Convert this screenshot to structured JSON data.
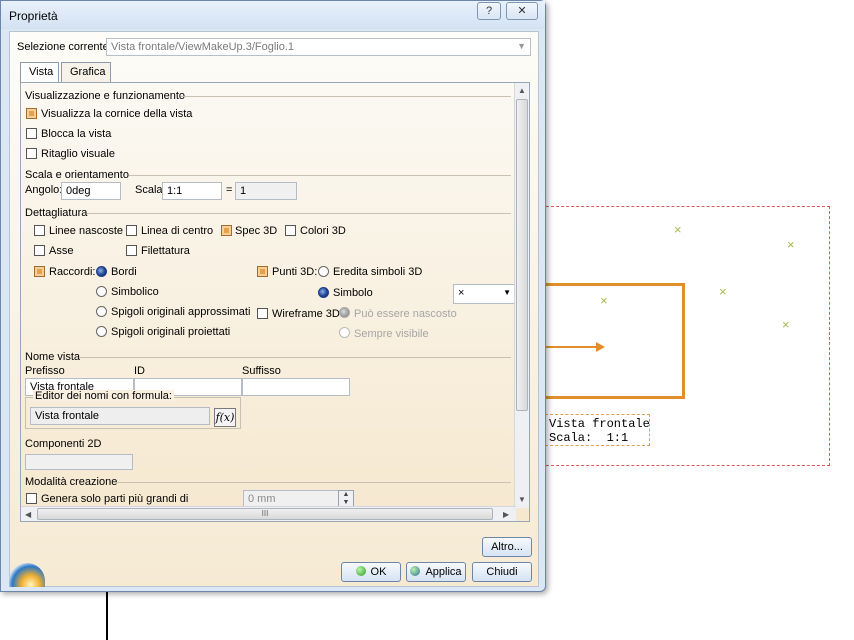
{
  "drawing": {
    "view_label_line1": "Vista frontale",
    "view_label_line2": "Scala:  1:1",
    "x_glyph": "×"
  },
  "dialog": {
    "title": "Proprietà",
    "help_label": "?",
    "close_label": "✕",
    "current_selection_label": "Selezione corrente:",
    "current_selection_value": "Vista frontale/ViewMakeUp.3/Foglio.1",
    "tabs": [
      {
        "label": "Vista",
        "active": true
      },
      {
        "label": "Grafica",
        "active": false
      }
    ],
    "visualization": {
      "section_title": "Visualizzazione e funzionamento",
      "show_frame_label": "Visualizza la cornice della vista",
      "show_frame_checked": true,
      "lock_view_label": "Blocca la vista",
      "lock_view_checked": false,
      "visual_clipping_label": "Ritaglio visuale",
      "visual_clipping_checked": false
    },
    "scale": {
      "section_title": "Scala e orientamento",
      "angle_label": "Angolo:",
      "angle_value": "0deg",
      "scale_label": "Scala:",
      "scale_value": "1:1",
      "equals_label": "=",
      "scale_result": "1"
    },
    "detail": {
      "section_title": "Dettagliatura",
      "hidden_lines_label": "Linee nascoste",
      "hidden_lines_checked": false,
      "center_line_label": "Linea di centro",
      "center_line_checked": false,
      "spec3d_label": "Spec 3D",
      "spec3d_checked": true,
      "colors3d_label": "Colori 3D",
      "colors3d_checked": false,
      "axis_label": "Asse",
      "axis_checked": false,
      "thread_label": "Filettatura",
      "thread_checked": false,
      "fillets_label": "Raccordi:",
      "fillets_checked": true,
      "fillet_options": [
        {
          "label": "Bordi",
          "selected": true
        },
        {
          "label": "Simbolico",
          "selected": false
        },
        {
          "label": "Spigoli originali approssimati",
          "selected": false
        },
        {
          "label": "Spigoli originali proiettati",
          "selected": false
        }
      ],
      "points3d_label": "Punti 3D:",
      "points3d_checked": true,
      "inherit_symbols_label": "Eredita simboli 3D",
      "symbol_label": "Simbolo",
      "symbol_value": "×",
      "wireframe3d_label": "Wireframe 3D",
      "wireframe3d_checked": false,
      "can_be_hidden_label": "Può essere nascosto",
      "always_visible_label": "Sempre visibile"
    },
    "view_name": {
      "section_title": "Nome vista",
      "prefix_label": "Prefisso",
      "id_label": "ID",
      "suffix_label": "Suffisso",
      "prefix_value": "Vista frontale",
      "id_value": "",
      "suffix_value": "",
      "formula_editor_label": "Editor dei nomi con formula:",
      "formula_value": "Vista frontale",
      "fx_label": "f(x)"
    },
    "components2d": {
      "section_title": "Componenti 2D",
      "value": ""
    },
    "creation_mode": {
      "section_title": "Modalità creazione",
      "generate_only_label": "Genera solo parti più grandi di",
      "generate_only_checked": false,
      "size_value": "0 mm"
    },
    "hscroll_grip": "III",
    "more_button": "Altro...",
    "ok_button": "OK",
    "apply_button": "Applica",
    "close_button": "Chiudi"
  }
}
